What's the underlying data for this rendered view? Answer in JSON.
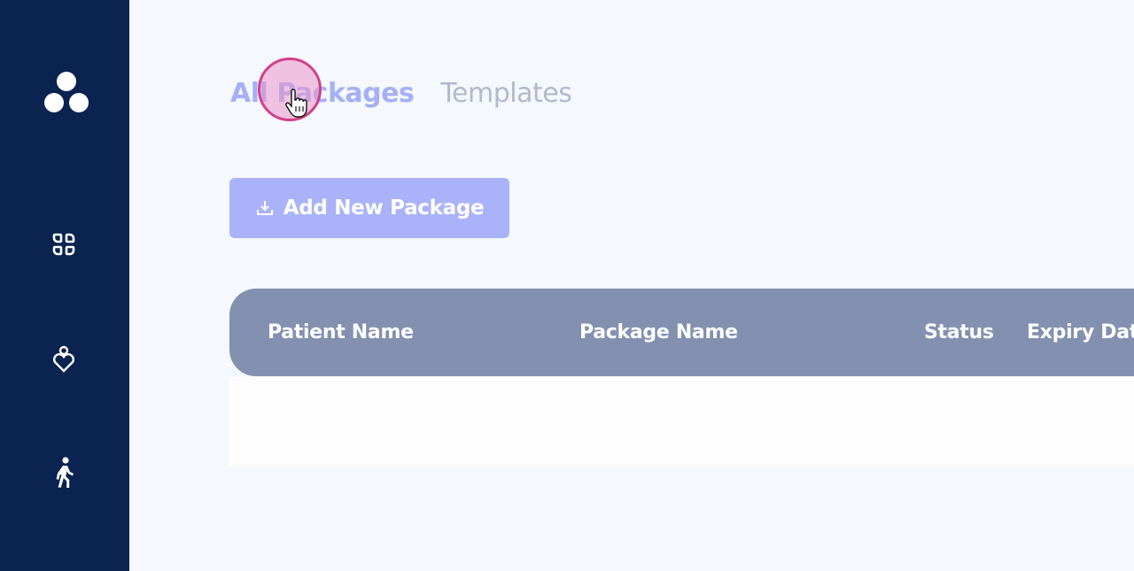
{
  "sidebar": {
    "logo": "three-circles-logo",
    "items": [
      {
        "icon": "dashboard-icon"
      },
      {
        "icon": "heart-person-icon"
      },
      {
        "icon": "walking-person-icon"
      }
    ]
  },
  "tabs": [
    {
      "label": "All Packages",
      "active": true
    },
    {
      "label": "Templates",
      "active": false
    }
  ],
  "actions": {
    "add_label": "Add New Package",
    "add_icon": "download-tray-icon"
  },
  "table": {
    "columns": [
      "Patient Name",
      "Package Name",
      "Status",
      "Expiry Dat"
    ]
  },
  "colors": {
    "sidebar": "#0a2350",
    "accent": "#aab3fa",
    "header": "#8390b0",
    "background": "#f5f8fc"
  }
}
